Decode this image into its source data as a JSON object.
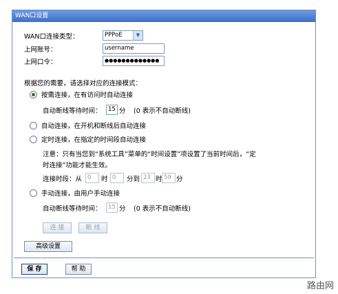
{
  "title": "WAN口设置",
  "conn_type": {
    "label": "WAN口连接类型：",
    "value": "PPPoE"
  },
  "account": {
    "label": "上网账号：",
    "value": "username"
  },
  "password": {
    "label": "上网口令：",
    "value": "●●●●●●●●●●●●●"
  },
  "prompt": "根据您的需要，请选择对应的连接模式：",
  "mode_on_demand": {
    "label": "按需连接，在有访问时自动连接",
    "selected": true
  },
  "idle1": {
    "label": "自动断线等待时间：",
    "value": "15",
    "unit": "分",
    "note": "(0 表示不自动断线)"
  },
  "mode_auto": {
    "label": "自动连接，在开机和断线后自动连接",
    "selected": false
  },
  "mode_timed": {
    "label": "定时连接，在指定的时间段自动连接",
    "selected": false
  },
  "notice_line1": "注意：只有当您到“系统工具”菜单的“时间设置”项设置了当前时间后，“定",
  "notice_line2": "时连接”功能才能生效。",
  "period": {
    "label": "连接时段：从",
    "h1": "0",
    "t1": "时",
    "m1": "0",
    "t2": "分到",
    "h2": "23",
    "t3": "时",
    "m2": "59",
    "t4": "分"
  },
  "mode_manual": {
    "label": "手动连接，由用户手动连接",
    "selected": false
  },
  "idle2": {
    "label": "自动断线等待时间：",
    "value": "15",
    "unit": "分",
    "note": "(0 表示不自动断线)"
  },
  "buttons": {
    "connect": "连 接",
    "disconnect": "断 线",
    "advanced": "高级设置",
    "save": "保 存",
    "help": "帮 助"
  },
  "watermark": "路由网",
  "colors": {
    "titlebar": "#4a7fd4",
    "border": "#6e8fcf"
  }
}
